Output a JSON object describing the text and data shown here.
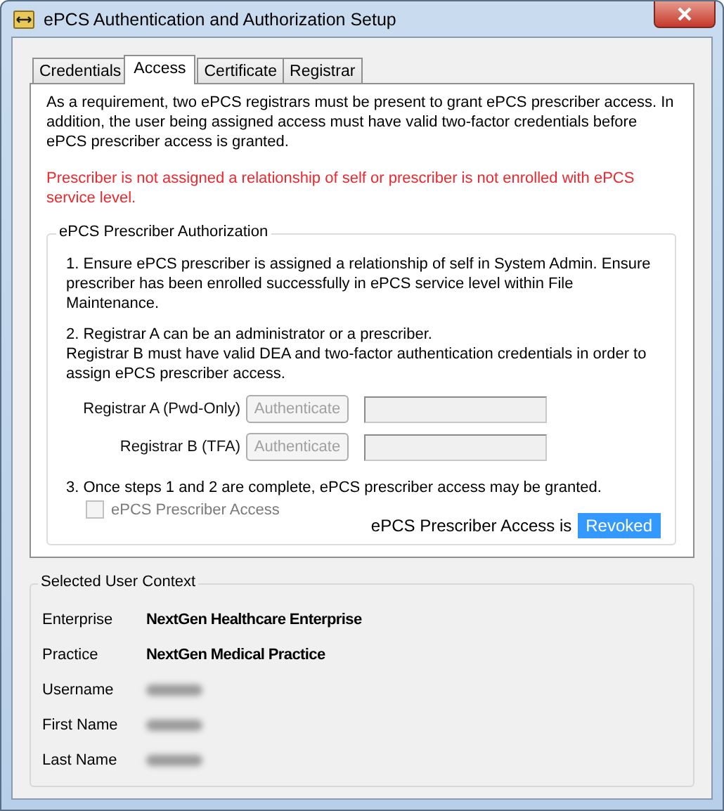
{
  "window": {
    "title": "ePCS Authentication and Authorization Setup"
  },
  "tabs": [
    {
      "label": "Credentials",
      "selected": false
    },
    {
      "label": "Access",
      "selected": true
    },
    {
      "label": "Certificate",
      "selected": false
    },
    {
      "label": "Registrar",
      "selected": false
    }
  ],
  "intro": "As a requirement, two ePCS registrars must be present to grant ePCS prescriber access. In addition, the user being assigned access must have valid two-factor credentials before ePCS prescriber access is granted.",
  "warning": "Prescriber is not assigned a relationship of self or prescriber is not enrolled with ePCS service level.",
  "authorization": {
    "title": "ePCS Prescriber Authorization",
    "step1": "1.  Ensure ePCS prescriber is assigned a relationship of self in System Admin. Ensure prescriber has been enrolled successfully in ePCS service level within File Maintenance.",
    "step2": [
      "2.  Registrar A can be an administrator or a prescriber.",
      "Registrar B must have valid DEA and two-factor authentication credentials in order to assign ePCS prescriber access."
    ],
    "registrars": [
      {
        "label": "Registrar A (Pwd-Only)",
        "button": "Authenticate",
        "disabled": true
      },
      {
        "label": "Registrar B (TFA)",
        "button": "Authenticate",
        "disabled": true
      }
    ],
    "step3": "3. Once steps 1 and 2 are complete, ePCS prescriber access may be granted.",
    "checkbox": {
      "label": "ePCS Prescriber Access",
      "checked": false,
      "disabled": true
    },
    "status_label": "ePCS Prescriber Access is",
    "status": "Revoked"
  },
  "user_context": {
    "title": "Selected User Context",
    "rows": [
      {
        "label": "Enterprise",
        "value": "NextGen Healthcare Enterprise",
        "redacted": false
      },
      {
        "label": "Practice",
        "value": "NextGen Medical Practice",
        "redacted": false
      },
      {
        "label": "Username",
        "redacted": true
      },
      {
        "label": "First Name",
        "redacted": true
      },
      {
        "label": "Last Name",
        "redacted": true
      }
    ]
  }
}
